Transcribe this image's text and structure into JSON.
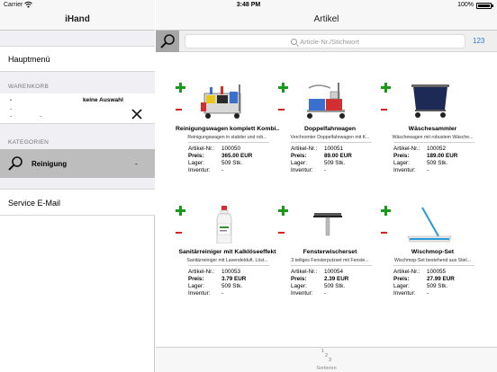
{
  "status": {
    "carrier": "Carrier",
    "time": "3:48 PM",
    "battery": "100%"
  },
  "sidebar": {
    "title": "iHand",
    "main_menu": "Hauptmenü",
    "cart_header": "WARENKORB",
    "cart": {
      "line1": "-",
      "empty_label": "keine Auswahl",
      "line2": "-",
      "line3": "-",
      "line3b": "-"
    },
    "categories_header": "KATEGORIEN",
    "categories": [
      {
        "label": "Reinigung",
        "dash": "-"
      }
    ],
    "service": "Service E-Mail"
  },
  "main": {
    "title": "Artikel",
    "search": {
      "placeholder": "Article-Nr./Stichwort",
      "number_toggle": "123"
    },
    "field_labels": {
      "artnr": "Artikel-Nr.:",
      "price": "Preis:",
      "stock": "Lager:",
      "inventory": "Inventur:"
    },
    "products": [
      {
        "name": "Reinigungswagen komplett Kombi...",
        "desc": "Reinigungswagen in stabiler und rob...",
        "artnr": "100050",
        "price": "365.00 EUR",
        "stock": "509 Stk.",
        "inventory": "-",
        "icon": "cleaning-cart-icon"
      },
      {
        "name": "Doppelfahrwagen",
        "desc": "Verchromter Doppelfahrwagen mit K...",
        "artnr": "100051",
        "price": "89.00 EUR",
        "stock": "509 Stk.",
        "inventory": "-",
        "icon": "mop-bucket-icon"
      },
      {
        "name": "Wäschesammler",
        "desc": "Wäschewagen mit robustem Wäsche...",
        "artnr": "100052",
        "price": "189.00 EUR",
        "stock": "509 Stk.",
        "inventory": "-",
        "icon": "laundry-cart-icon"
      },
      {
        "name": "Sanitärreiniger mit Kalklöseeffekt",
        "desc": "Sanitärreiniger mit Lavendelduft. Löst...",
        "artnr": "100053",
        "price": "3.79 EUR",
        "stock": "509 Stk.",
        "inventory": "-",
        "icon": "cleaner-bottle-icon"
      },
      {
        "name": "Fensterwischerset",
        "desc": "3 teiliges Fensterputzset mit Fenste...",
        "artnr": "100054",
        "price": "2.39 EUR",
        "stock": "509 Stk.",
        "inventory": "-",
        "icon": "window-squeegee-icon"
      },
      {
        "name": "Wischmop-Set",
        "desc": "Wischmop-Set bestehend aus Stiel...",
        "artnr": "100055",
        "price": "27.99 EUR",
        "stock": "509 Stk.",
        "inventory": "-",
        "icon": "wet-mop-icon"
      }
    ],
    "sort": {
      "digits": [
        "1",
        "2",
        "3"
      ],
      "label": "Sortieren"
    }
  },
  "colors": {
    "add": "#1a9a1a",
    "remove": "#e02020",
    "accent": "#3478c6",
    "selected_category": "#bdbdbd"
  }
}
